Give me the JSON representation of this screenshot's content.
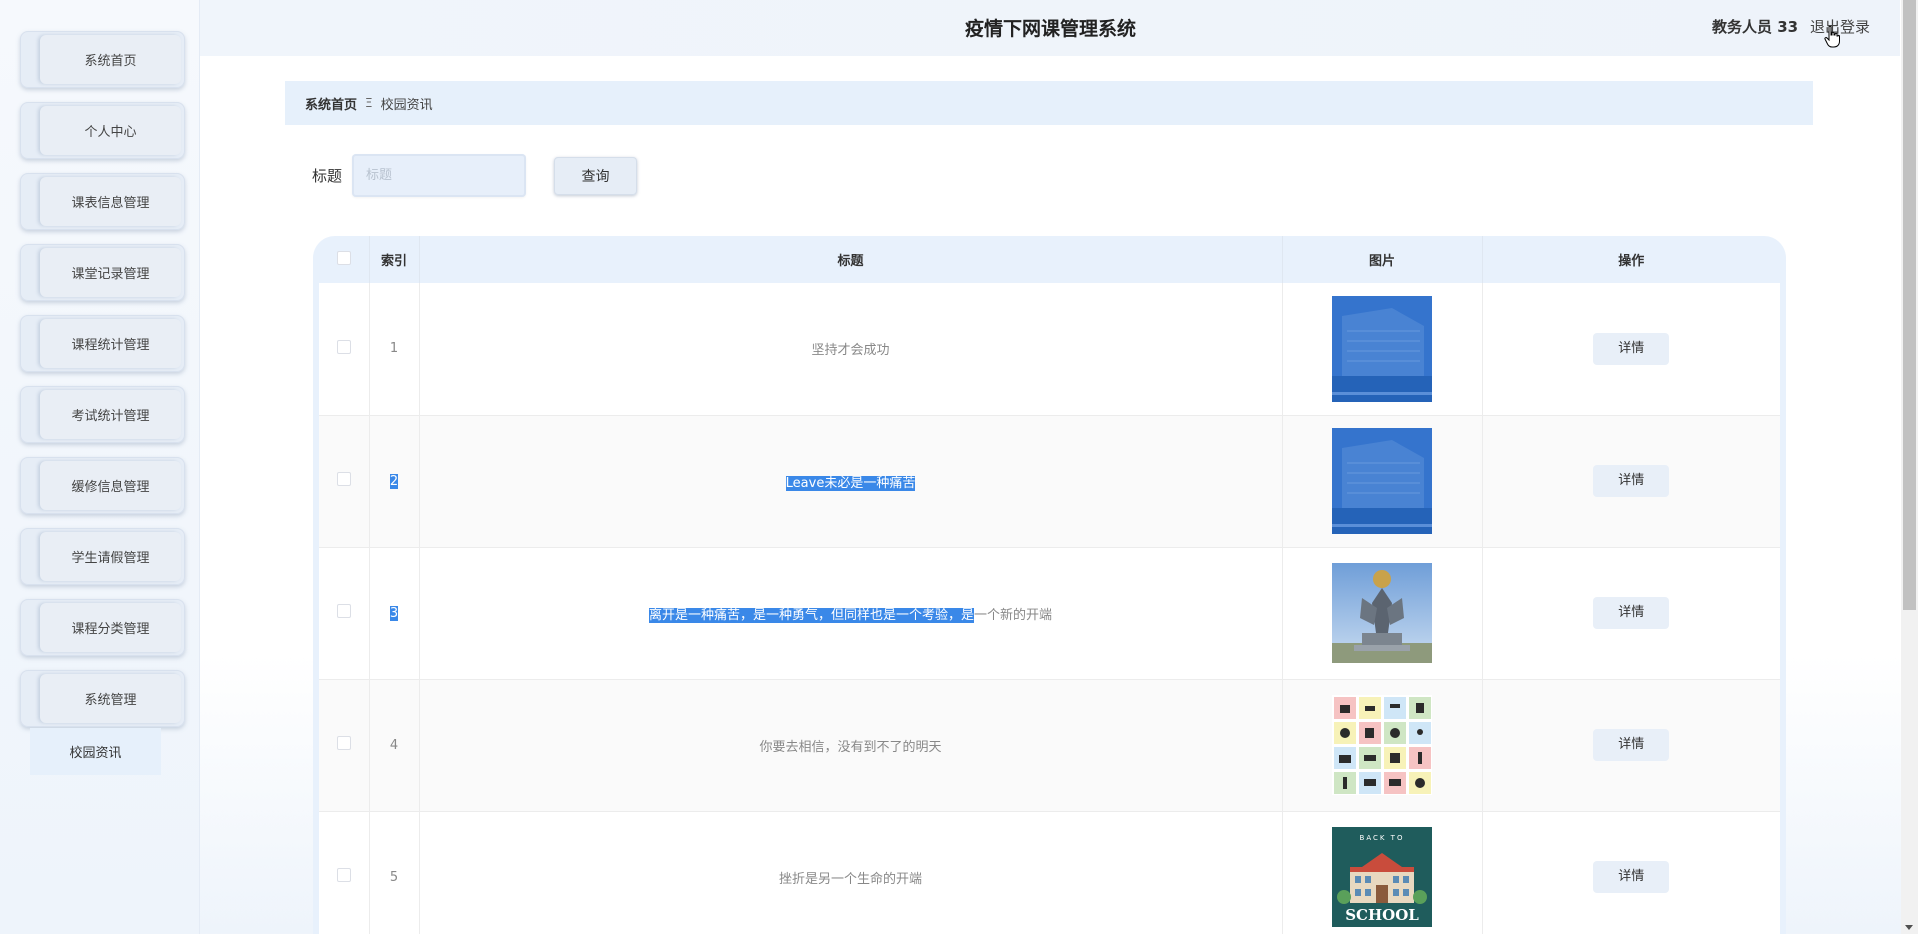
{
  "sidebar": {
    "items": [
      {
        "label": "系统首页"
      },
      {
        "label": "个人中心"
      },
      {
        "label": "课表信息管理"
      },
      {
        "label": "课堂记录管理"
      },
      {
        "label": "课程统计管理"
      },
      {
        "label": "考试统计管理"
      },
      {
        "label": "缓修信息管理"
      },
      {
        "label": "学生请假管理"
      },
      {
        "label": "课程分类管理"
      },
      {
        "label": "系统管理"
      }
    ],
    "submenu": {
      "label": "校园资讯"
    }
  },
  "header": {
    "title": "疫情下网课管理系统",
    "user": "教务人员 33",
    "logout": "退出登录"
  },
  "breadcrumb": {
    "home": "系统首页",
    "separator": "Ξ",
    "current": "校园资讯"
  },
  "search": {
    "label": "标题",
    "placeholder": "标题",
    "button": "查询"
  },
  "table": {
    "headers": {
      "index": "索引",
      "title": "标题",
      "image": "图片",
      "action": "操作"
    },
    "detail_label": "详情",
    "rows": [
      {
        "index": "1",
        "title": "坚持才会成功"
      },
      {
        "index": "2",
        "title": "Leave未必是一种痛苦"
      },
      {
        "index": "3",
        "title_selected": "离开是一种痛苦，是一种勇气，但同样也是一个考验，是",
        "title_rest": "一个新的开端"
      },
      {
        "index": "4",
        "title": "你要去相信，没有到不了的明天"
      },
      {
        "index": "5",
        "title": "挫折是另一个生命的开端",
        "image_text": "SCHOOL",
        "image_subtext": "BACK TO"
      }
    ]
  },
  "colors": {
    "accent": "#3a88e8",
    "sidebar_bg": "#eef4fb",
    "header_bg": "#f0f5fb"
  }
}
